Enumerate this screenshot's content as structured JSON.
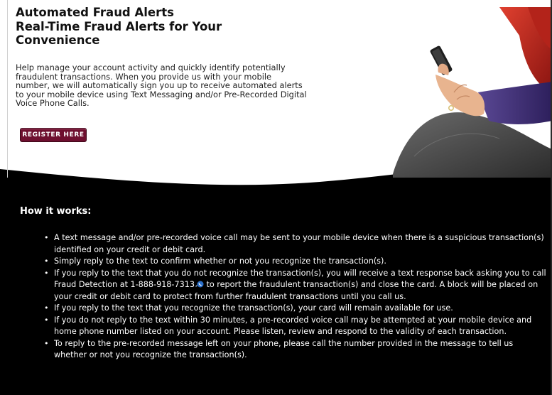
{
  "hero": {
    "title_line1": "Automated Fraud Alerts",
    "title_line2": "Real-Time Fraud Alerts for Your",
    "title_line3": "Convenience",
    "intro": "Help manage your account activity and quickly identify potentially fraudulent transactions. When you provide us with your mobile number, we will automatically sign you up to receive automated alerts to your mobile device using Text Messaging and/or Pre-Recorded Digital Voice Phone Calls.",
    "register_label": "Register Here"
  },
  "how": {
    "title": "How it works:",
    "items": [
      "A text message and/or pre-recorded voice call may be sent to your mobile device when there is a suspicious transaction(s) identified on your credit or debit card.",
      "Simply reply to the text to confirm whether or not you recognize the transaction(s).",
      {
        "before": "If you reply to the text that you do not recognize the transaction(s), you will receive a text response back asking you to call Fraud Detection at ",
        "phone": "1-888-918-7313",
        "after": " to report the fraudulent transaction(s) and close the card. A block will be placed on your credit or debit card to protect from further fraudulent transactions until you call us."
      },
      "If you reply to the text that you recognize the transaction(s), your card will remain available for use.",
      "If you do not reply to the text within 30 minutes, a pre-recorded voice call may be attempted at your mobile device and home phone number listed on your account. Please listen, review and respond to the validity of each transaction.",
      "To reply to the pre-recorded message left on your phone, please call the number provided in the message to tell us whether or not you recognize the transaction(s)."
    ]
  },
  "colors": {
    "button": "#6e0f2f",
    "dark_background": "#000000",
    "accent_red": "#c0271d",
    "sleeve_purple": "#3d2a74"
  },
  "icons": [
    "phone-icon"
  ]
}
